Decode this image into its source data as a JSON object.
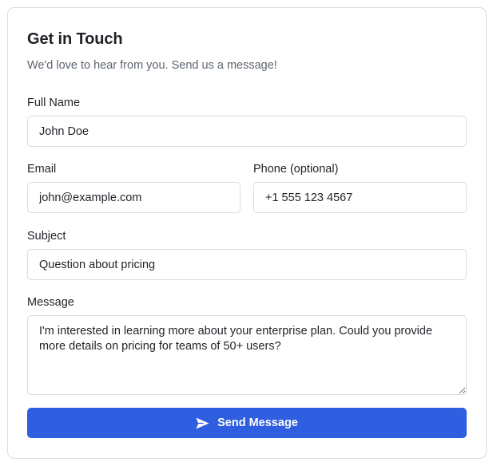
{
  "form": {
    "title": "Get in Touch",
    "subtitle": "We'd love to hear from you. Send us a message!",
    "full_name": {
      "label": "Full Name",
      "value": "John Doe"
    },
    "email": {
      "label": "Email",
      "value": "john@example.com"
    },
    "phone": {
      "label": "Phone (optional)",
      "value": "+1 555 123 4567"
    },
    "subject": {
      "label": "Subject",
      "value": "Question about pricing"
    },
    "message": {
      "label": "Message",
      "value": "I'm interested in learning more about your enterprise plan. Could you provide more details on pricing for teams of 50+ users?"
    },
    "submit": {
      "label": "Send Message",
      "icon": "send-icon"
    }
  },
  "colors": {
    "accent": "#2f5ee0",
    "border": "#d9dce1",
    "text": "#1f2328",
    "muted_text": "#5c6570"
  }
}
